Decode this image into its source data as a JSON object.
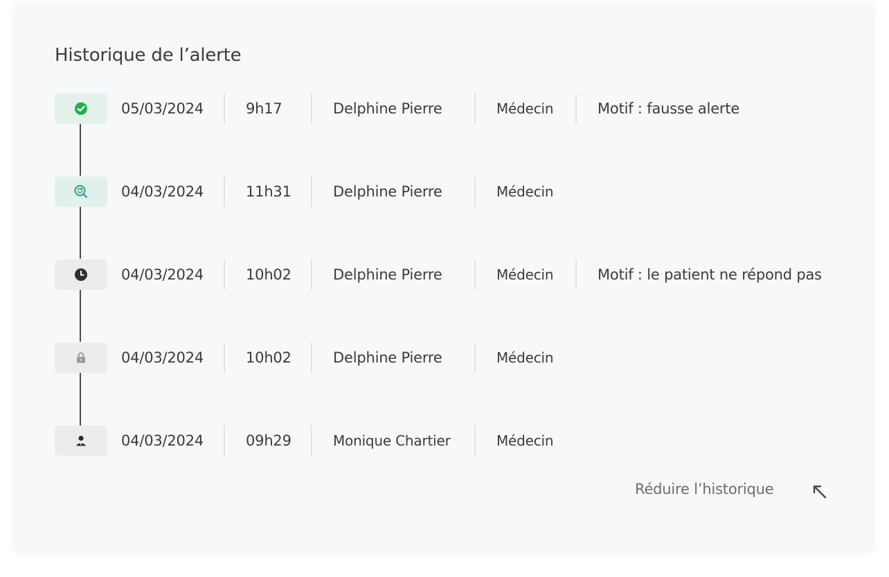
{
  "panel": {
    "title": "Historique de l’alerte"
  },
  "history": [
    {
      "icon": "check-circle-icon",
      "date": "05/03/2024",
      "time": "9h17",
      "name": "Delphine Pierre",
      "role": "Médecin",
      "motif": "Motif : fausse alerte"
    },
    {
      "icon": "search-refresh-icon",
      "date": "04/03/2024",
      "time": "11h31",
      "name": "Delphine Pierre",
      "role": "Médecin",
      "motif": ""
    },
    {
      "icon": "clock-icon",
      "date": "04/03/2024",
      "time": "10h02",
      "name": "Delphine Pierre",
      "role": "Médecin",
      "motif": "Motif : le patient ne répond pas"
    },
    {
      "icon": "lock-icon",
      "date": "04/03/2024",
      "time": "10h02",
      "name": "Delphine Pierre",
      "role": "Médecin",
      "motif": ""
    },
    {
      "icon": "user-icon",
      "date": "04/03/2024",
      "time": "09h29",
      "name": "Monique Chartier",
      "role": "Médecin",
      "motif": ""
    }
  ],
  "footer": {
    "collapse_label": "Réduire l’historique",
    "collapse_icon": "arrow-up-left-icon"
  },
  "colors": {
    "success": "#22b04b",
    "teal": "#3fa394",
    "dark": "#2e2e2e",
    "muted_icon": "#9a9a9a",
    "card_background": "#f7f8fa",
    "text": "#3b3b3b"
  }
}
